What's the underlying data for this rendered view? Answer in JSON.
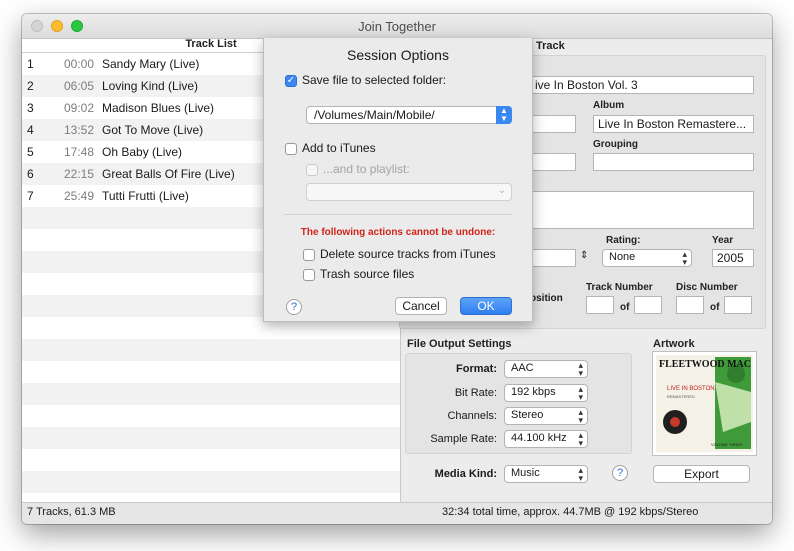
{
  "window": {
    "title": "Join Together"
  },
  "track_list": {
    "header": "Track List",
    "rows": [
      {
        "num": "1",
        "time": "00:00",
        "name": "Sandy Mary (Live)"
      },
      {
        "num": "2",
        "time": "06:05",
        "name": "Loving Kind (Live)"
      },
      {
        "num": "3",
        "time": "09:02",
        "name": "Madison Blues (Live)"
      },
      {
        "num": "4",
        "time": "13:52",
        "name": "Got To Move (Live)"
      },
      {
        "num": "5",
        "time": "17:48",
        "name": "Oh Baby (Live)"
      },
      {
        "num": "6",
        "time": "22:15",
        "name": "Great Balls Of Fire (Live)"
      },
      {
        "num": "7",
        "time": "25:49",
        "name": "Tutti Frutti (Live)"
      }
    ]
  },
  "status": {
    "left": "7 Tracks, 61.3 MB",
    "right": "32:34 total time, approx. 44.7MB @ 192 kbps/Stereo"
  },
  "track_info": {
    "title_partial": "Track",
    "name_value": "ive In Boston Vol. 3",
    "album_label": "Album",
    "album_value": "Live In Boston Remastere...",
    "grouping_label": "Grouping",
    "rating_label": "Rating:",
    "rating_value": "None",
    "year_label": "Year",
    "year_value": "2005",
    "position_partial": "osition",
    "track_number_label": "Track Number",
    "disc_number_label": "Disc Number",
    "of_label": "of"
  },
  "output": {
    "title": "File Output Settings",
    "format_label": "Format:",
    "format_value": "AAC",
    "bitrate_label": "Bit Rate:",
    "bitrate_value": "192 kbps",
    "channels_label": "Channels:",
    "channels_value": "Stereo",
    "samplerate_label": "Sample Rate:",
    "samplerate_value": "44.100 kHz",
    "media_kind_label": "Media Kind:",
    "media_kind_value": "Music"
  },
  "artwork": {
    "title": "Artwork",
    "export_label": "Export",
    "cover_text": {
      "band": "FLEETWOOD MAC",
      "album": "LIVE IN BOSTON",
      "sub": "REMASTERED",
      "vol": "VOLUME THREE"
    }
  },
  "sheet": {
    "title": "Session Options",
    "save_label": "Save file to selected folder:",
    "save_checked": true,
    "folder_value": "/Volumes/Main/Mobile/",
    "itunes_label": "Add to iTunes",
    "playlist_label": "...and to playlist:",
    "warning": "The following actions cannot be undone:",
    "delete_label": "Delete source tracks from iTunes",
    "trash_label": "Trash source files",
    "help": "?",
    "cancel": "Cancel",
    "ok": "OK"
  },
  "colors": {
    "accent": "#3b87f2",
    "warning": "#d0251c"
  },
  "icons": {
    "help": "question-mark-icon",
    "popup": "chevron-updown-icon"
  }
}
